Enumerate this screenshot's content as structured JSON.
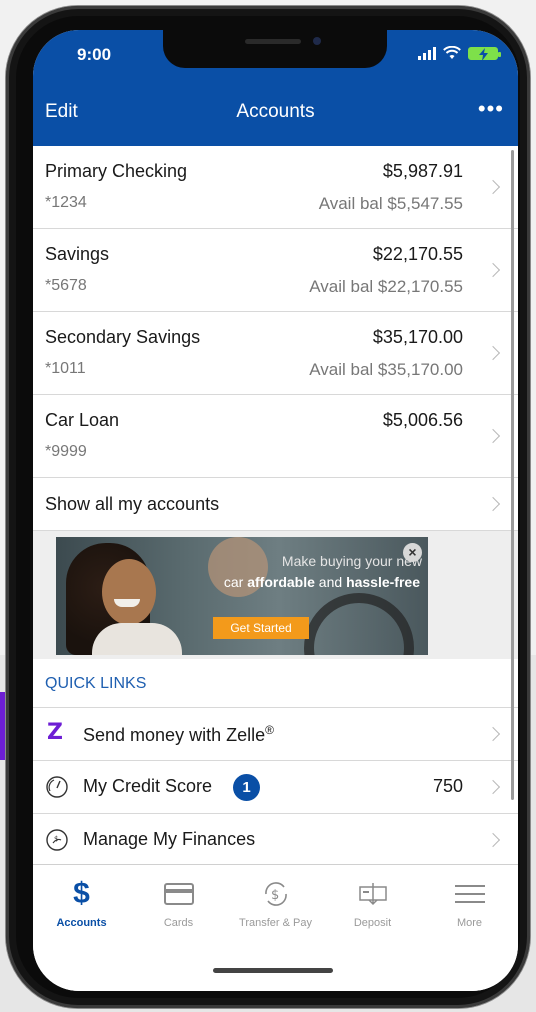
{
  "status": {
    "time": "9:00"
  },
  "nav": {
    "edit": "Edit",
    "title": "Accounts",
    "more": "•••"
  },
  "accounts": [
    {
      "name": "Primary Checking",
      "number": "*1234",
      "balance": "$5,987.91",
      "avail": "Avail bal $5,547.55"
    },
    {
      "name": "Savings",
      "number": "*5678",
      "balance": "$22,170.55",
      "avail": "Avail bal $22,170.55"
    },
    {
      "name": "Secondary Savings",
      "number": "*1011",
      "balance": "$35,170.00",
      "avail": "Avail bal $35,170.00"
    },
    {
      "name": "Car Loan",
      "number": "*9999",
      "balance": "$5,006.56",
      "avail": ""
    }
  ],
  "show_all": "Show all my accounts",
  "ad": {
    "line1": "Make buying your new",
    "line2_pre": "car ",
    "line2_b1": "affordable",
    "line2_mid": " and ",
    "line2_b2": "hassle-free",
    "cta": "Get Started",
    "close": "×"
  },
  "quick_links": {
    "header": "QUICK LINKS",
    "zelle": {
      "label": "Send money with Zelle",
      "sup": "®",
      "icon": "zelle-icon",
      "glyph": "Z"
    },
    "credit": {
      "label": "My Credit Score",
      "badge": "1",
      "value": "750"
    },
    "finances": {
      "label": "Manage My Finances"
    }
  },
  "tabs": [
    {
      "label": "Accounts",
      "active": true
    },
    {
      "label": "Cards",
      "active": false
    },
    {
      "label": "Transfer & Pay",
      "active": false
    },
    {
      "label": "Deposit",
      "active": false
    },
    {
      "label": "More",
      "active": false
    }
  ],
  "colors": {
    "brand_blue": "#0a4fa6",
    "zelle_purple": "#6d1ed4",
    "cta_orange": "#f39a1b",
    "battery_green": "#7ee04a"
  }
}
